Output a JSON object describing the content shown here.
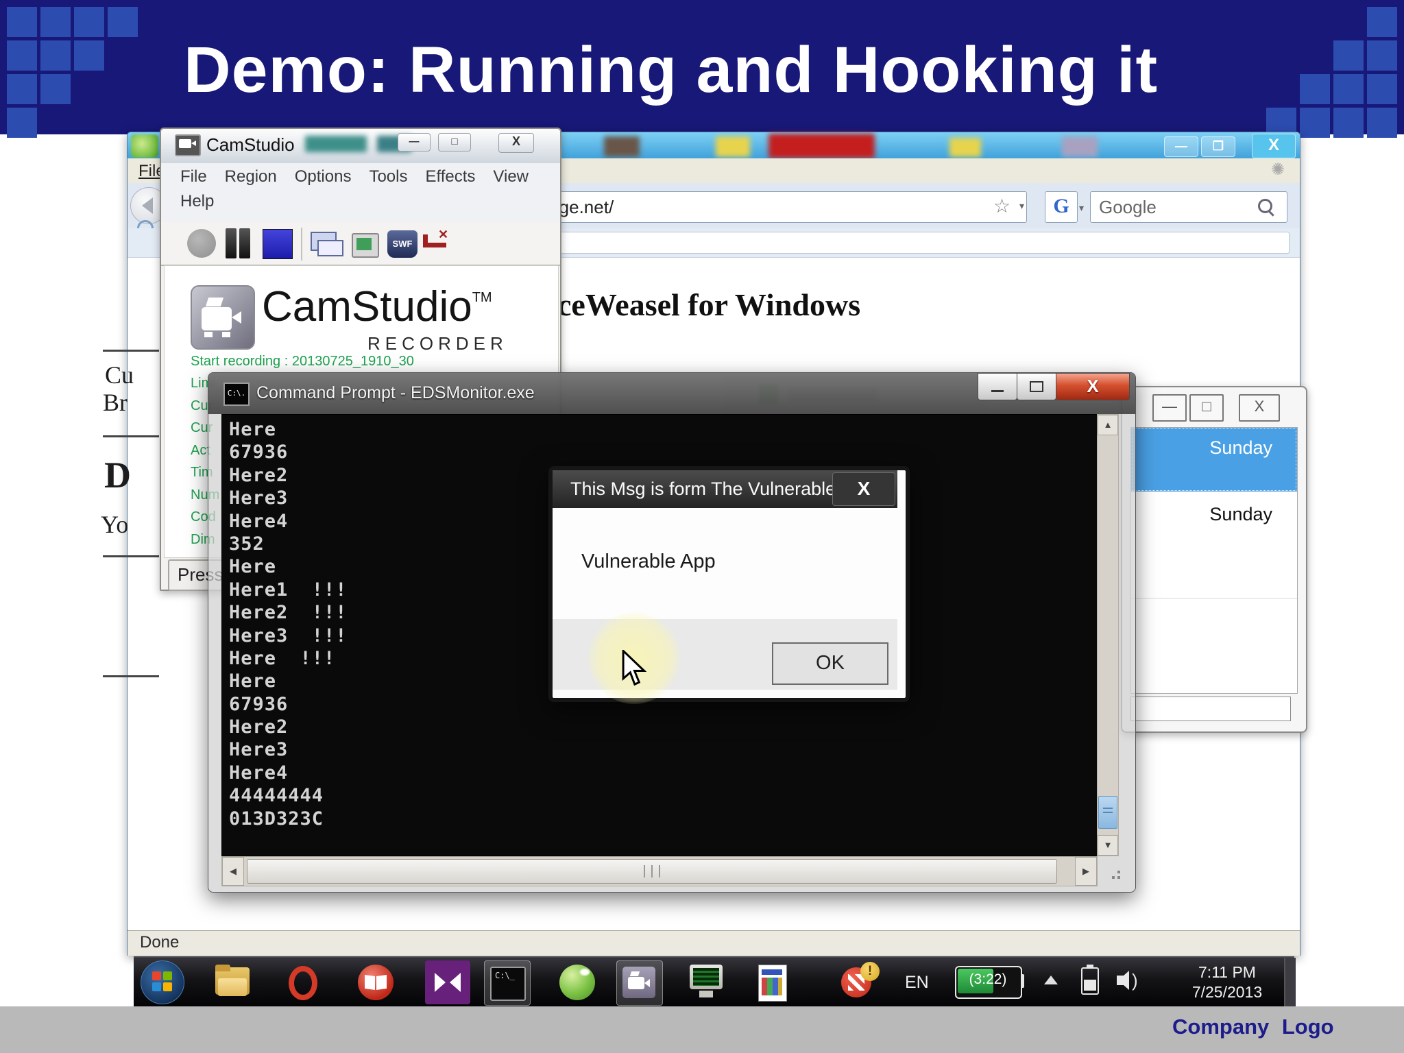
{
  "slide": {
    "title": "Demo: Running and Hooking it",
    "footer": "Company Logo"
  },
  "doc_fragments": {
    "frag1": "Cu",
    "frag2": "Br",
    "frag3": "D",
    "frag4": "Yo"
  },
  "browser": {
    "file_menu": "File",
    "address": "rge.net/",
    "search_engine_letter": "G",
    "search_text": "Google",
    "heading": "ceWeasel for Windows",
    "status": "Done"
  },
  "camstudio": {
    "title": "CamStudio",
    "menu_items": [
      "File",
      "Region",
      "Options",
      "Tools",
      "Effects",
      "View"
    ],
    "menu_row2": "Help",
    "logo_text": "CamStudio",
    "logo_tm": "TM",
    "logo_sub": "RECORDER",
    "start_line": "Start recording : 20130725_1910_30",
    "info_lines": [
      "Limi",
      "Cur",
      "Cur",
      "Act",
      "Tim",
      "Num",
      "Cod",
      "Dim"
    ],
    "status_text": "Press"
  },
  "cmd": {
    "title": "Command Prompt - EDSMonitor.exe",
    "icon_text": "C:\\.",
    "lines": [
      "Here",
      "67936",
      "Here2",
      "Here3",
      "Here4",
      "352",
      "Here",
      "Here1  !!!",
      "Here2  !!!",
      "Here3  !!!",
      "Here  !!!",
      "Here",
      "67936",
      "Here2",
      "Here3",
      "Here4",
      "44444444",
      "013D323C"
    ]
  },
  "dialog": {
    "title": "This Msg is form The Vulnerable A...",
    "close_label": "X",
    "body": "Vulnerable App",
    "ok_label": "OK"
  },
  "vulnapp": {
    "row_selected": "Sunday",
    "row_second": "Sunday"
  },
  "taskbar": {
    "language": "EN",
    "battery_remaining": "(3:22)",
    "time": "7:11 PM",
    "date": "7/25/2013"
  }
}
